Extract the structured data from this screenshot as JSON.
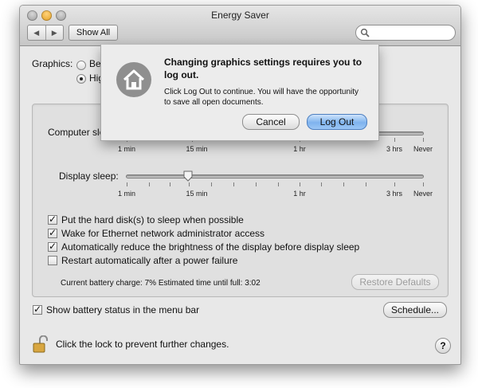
{
  "window": {
    "title": "Energy Saver"
  },
  "toolbar": {
    "back_label": "◀",
    "forward_label": "▶",
    "show_all_label": "Show All",
    "search_placeholder": ""
  },
  "graphics": {
    "label": "Graphics:",
    "options": [
      {
        "label": "Better",
        "selected": false
      },
      {
        "label": "Higher",
        "selected": true
      }
    ]
  },
  "computer_sleep": {
    "label": "Computer sleep:",
    "ticks": [
      "1 min",
      "15 min",
      "1 hr",
      "3 hrs",
      "Never"
    ]
  },
  "display_sleep": {
    "label": "Display sleep:",
    "ticks": [
      "1 min",
      "15 min",
      "1 hr",
      "3 hrs",
      "Never"
    ],
    "value": "15 min"
  },
  "options": [
    {
      "label": "Put the hard disk(s) to sleep when possible",
      "checked": true
    },
    {
      "label": "Wake for Ethernet network administrator access",
      "checked": true
    },
    {
      "label": "Automatically reduce the brightness of the display before display sleep",
      "checked": true
    },
    {
      "label": "Restart automatically after a power failure",
      "checked": false
    }
  ],
  "battery_status": "Current battery charge: 7%  Estimated time until full: 3:02",
  "restore_defaults_label": "Restore Defaults",
  "menu_bar_checkbox": {
    "label": "Show battery status in the menu bar",
    "checked": true
  },
  "schedule_label": "Schedule...",
  "lock_text": "Click the lock to prevent further changes.",
  "help_label": "?",
  "sheet": {
    "title": "Changing graphics settings requires you to log out.",
    "body": "Click Log Out to continue. You will have the opportunity to save all open documents.",
    "cancel_label": "Cancel",
    "logout_label": "Log Out"
  },
  "colors": {
    "default_button": "#7fb3ee",
    "window_bg": "#e8e8e8"
  }
}
